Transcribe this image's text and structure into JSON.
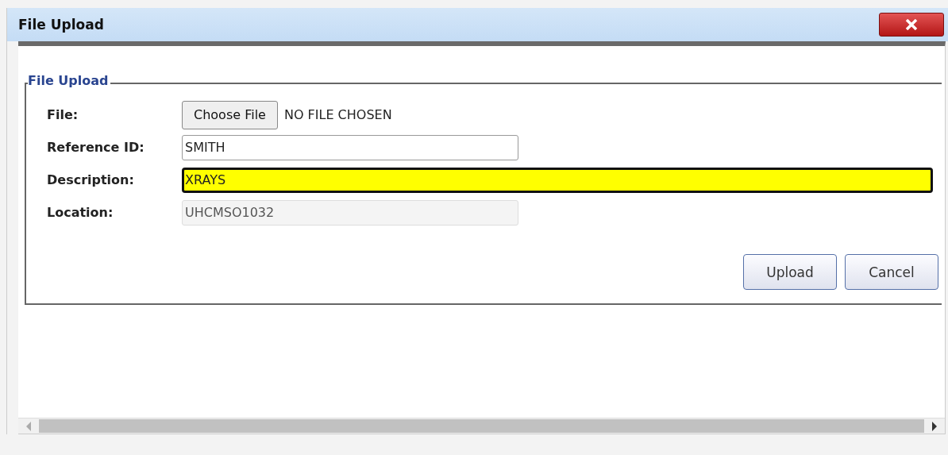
{
  "window": {
    "title": "File Upload"
  },
  "fieldset": {
    "legend": "File Upload",
    "fields": [
      {
        "kind": "file",
        "label": "File:",
        "button": "Choose File",
        "status": "NO FILE CHOSEN"
      },
      {
        "kind": "text",
        "label": "Reference ID:",
        "value": "SMITH",
        "highlighted": false,
        "disabled": false
      },
      {
        "kind": "text",
        "label": "Description:",
        "value": "XRAYS",
        "highlighted": true,
        "disabled": false
      },
      {
        "kind": "text",
        "label": "Location:",
        "value": "UHCMSO1032",
        "highlighted": false,
        "disabled": true
      }
    ],
    "buttons": [
      "Upload",
      "Cancel"
    ]
  }
}
